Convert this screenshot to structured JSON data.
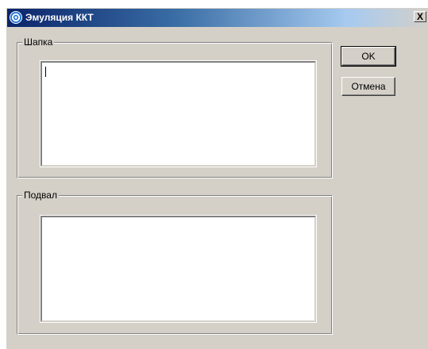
{
  "window": {
    "title": "Эмуляция ККТ",
    "icon": "settings-gear-icon",
    "close_label": "X"
  },
  "groups": {
    "header": {
      "label": "Шапка",
      "value": ""
    },
    "footer": {
      "label": "Подвал",
      "value": ""
    }
  },
  "buttons": {
    "ok_label": "OK",
    "cancel_label": "Отмена"
  },
  "colors": {
    "titlebar_start": "#0a246a",
    "titlebar_end": "#a6caf0",
    "face": "#d4d0c8"
  }
}
